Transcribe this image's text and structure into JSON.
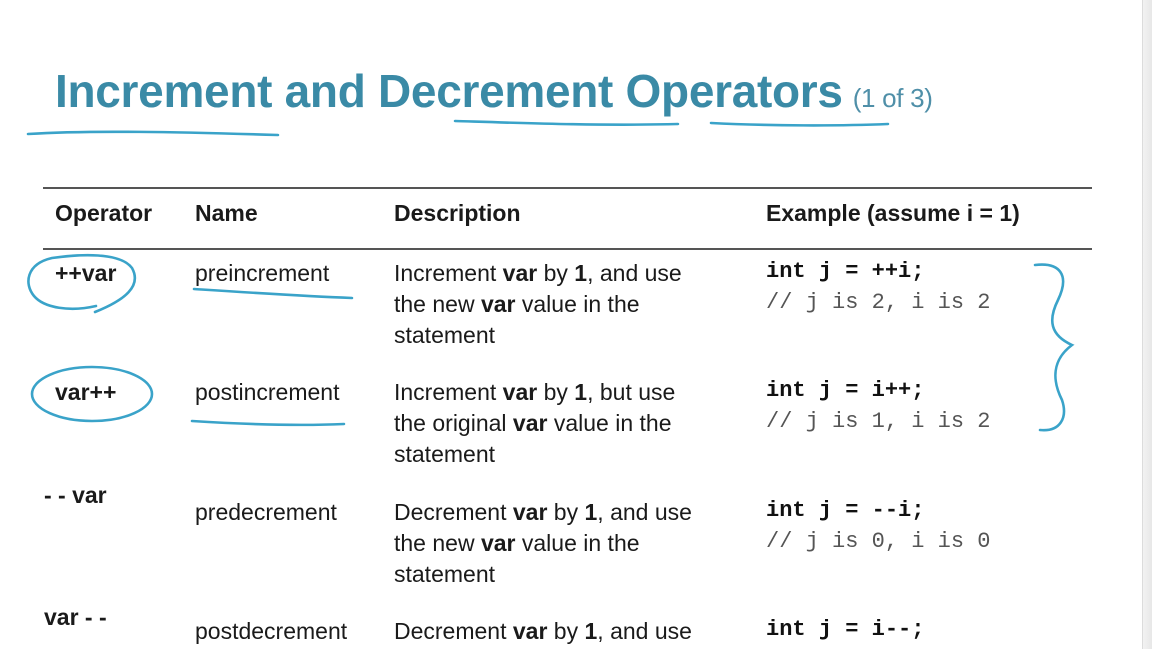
{
  "slide": {
    "title": "Increment and Decrement Operators",
    "count": "(1 of 3)"
  },
  "table": {
    "headers": {
      "operator": "Operator",
      "name": "Name",
      "description": "Description",
      "example": "Example (assume i = 1)"
    },
    "rows": [
      {
        "operator": "++var",
        "name": "preincrement",
        "desc": [
          [
            {
              "t": "Increment "
            },
            {
              "t": "var",
              "b": true
            },
            {
              "t": " by "
            },
            {
              "t": "1",
              "b": true
            },
            {
              "t": ", and use"
            }
          ],
          [
            {
              "t": "the new "
            },
            {
              "t": "var",
              "b": true
            },
            {
              "t": " value in the"
            }
          ],
          [
            {
              "t": "statement"
            }
          ]
        ],
        "code": "int j = ++i;",
        "comment": "// j is 2, i is 2"
      },
      {
        "operator": "var++",
        "name": "postincrement",
        "desc": [
          [
            {
              "t": "Increment "
            },
            {
              "t": "var",
              "b": true
            },
            {
              "t": " by "
            },
            {
              "t": "1",
              "b": true
            },
            {
              "t": ", but use"
            }
          ],
          [
            {
              "t": "the original "
            },
            {
              "t": "var",
              "b": true
            },
            {
              "t": " value in the"
            }
          ],
          [
            {
              "t": "statement"
            }
          ]
        ],
        "code": "int j = i++;",
        "comment": "// j is 1, i is 2"
      },
      {
        "operator": "- - var",
        "name": "predecrement",
        "desc": [
          [
            {
              "t": "Decrement "
            },
            {
              "t": "var",
              "b": true
            },
            {
              "t": " by "
            },
            {
              "t": "1",
              "b": true
            },
            {
              "t": ", and use"
            }
          ],
          [
            {
              "t": "the new "
            },
            {
              "t": "var",
              "b": true
            },
            {
              "t": " value in the"
            }
          ],
          [
            {
              "t": "statement"
            }
          ]
        ],
        "code": "int j = --i;",
        "comment": "// j is 0, i is 0"
      },
      {
        "operator": "var - -",
        "name": "postdecrement",
        "desc": [
          [
            {
              "t": "Decrement "
            },
            {
              "t": "var",
              "b": true
            },
            {
              "t": " by "
            },
            {
              "t": "1",
              "b": true
            },
            {
              "t": ", and use"
            }
          ]
        ],
        "code": "int j = i--;",
        "comment": ""
      }
    ]
  },
  "colors": {
    "title": "#3a8aa6",
    "annotation": "#3aa3c9"
  }
}
